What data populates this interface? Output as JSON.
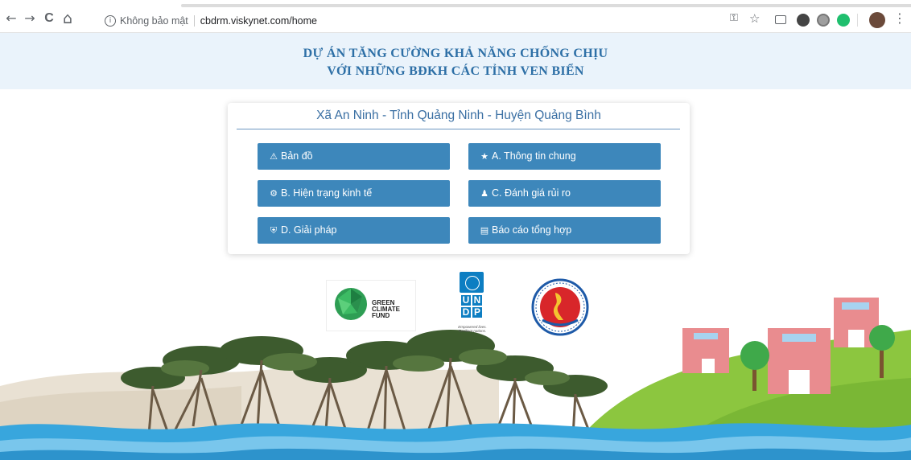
{
  "browser": {
    "security_label": "Không bảo mật",
    "url": "cbdrm.viskynet.com/home",
    "back_glyph": "←",
    "forward_glyph": "→",
    "reload_glyph": "C",
    "home_glyph": "⌂",
    "info_glyph": "i",
    "key_glyph": "⚿",
    "star_glyph": "☆",
    "menu_glyph": "⋮"
  },
  "header": {
    "line1": "DỰ ÁN TĂNG CƯỜNG KHẢ NĂNG CHỐNG CHỊU",
    "line2": "VỚI NHỮNG BĐKH CÁC TỈNH VEN BIỂN"
  },
  "card": {
    "title": "Xã An Ninh - Tỉnh Quảng Ninh - Huyện Quảng Bình",
    "buttons": [
      {
        "label": "Bản đồ",
        "icon": "⚠"
      },
      {
        "label": "A. Thông tin chung",
        "icon": "★"
      },
      {
        "label": "B. Hiện trạng kinh tế",
        "icon": "⚙"
      },
      {
        "label": "C. Đánh giá rủi ro",
        "icon": "♟"
      },
      {
        "label": "D. Giải pháp",
        "icon": "⛨"
      },
      {
        "label": "Báo cáo tổng hợp",
        "icon": "▤"
      }
    ]
  },
  "logos": {
    "gcf": [
      "GREEN",
      "CLIMATE",
      "FUND"
    ],
    "undp_letters": [
      "U",
      "N",
      "D",
      "P"
    ],
    "undp_tagline": [
      "Empowered lives.",
      "Resilient nations."
    ]
  },
  "colors": {
    "accent": "#3d87bb",
    "header_text": "#2d6fa6",
    "banner_bg": "#eaf3fb"
  }
}
